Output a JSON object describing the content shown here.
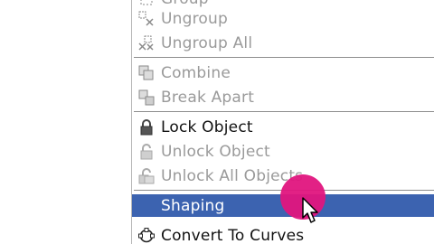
{
  "context_menu": {
    "items": [
      {
        "label": "Group",
        "icon": "group-icon",
        "disabled": true
      },
      {
        "label": "Ungroup",
        "icon": "ungroup-icon",
        "disabled": true
      },
      {
        "label": "Ungroup All",
        "icon": "ungroup-all-icon",
        "disabled": true
      },
      {
        "label": "Combine",
        "icon": "combine-icon",
        "disabled": true
      },
      {
        "label": "Break Apart",
        "icon": "break-apart-icon",
        "disabled": true
      },
      {
        "label": "Lock Object",
        "icon": "lock-icon",
        "disabled": false
      },
      {
        "label": "Unlock Object",
        "icon": "unlock-icon",
        "disabled": true
      },
      {
        "label": "Unlock All Objects",
        "icon": "unlock-all-icon",
        "disabled": true
      },
      {
        "label": "Shaping",
        "icon": "",
        "disabled": false,
        "selected": true
      },
      {
        "label": "Convert To Curves",
        "icon": "convert-to-curves-icon",
        "disabled": false
      }
    ]
  },
  "colors": {
    "selection": "#3c63b0",
    "cursor_highlight": "#e0157e",
    "disabled_text": "#9a9a9a"
  }
}
